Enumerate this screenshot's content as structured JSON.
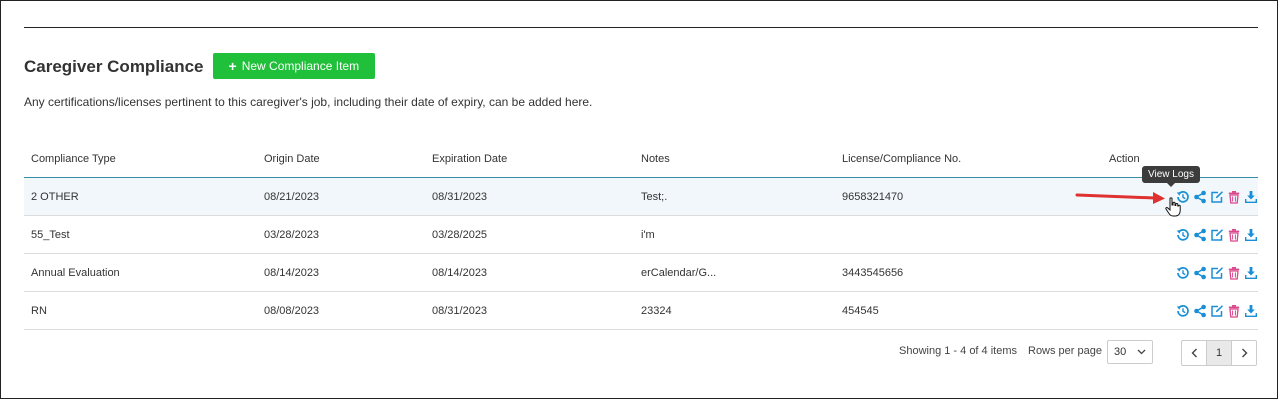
{
  "title": "Caregiver Compliance",
  "new_button": "New Compliance Item",
  "description": "Any certifications/licenses pertinent to this caregiver's job, including their date of expiry, can be added here.",
  "columns": [
    "Compliance Type",
    "Origin Date",
    "Expiration Date",
    "Notes",
    "License/Compliance No.",
    "Action"
  ],
  "rows": [
    {
      "type": "2 OTHER",
      "origin": "08/21/2023",
      "expiration": "08/31/2023",
      "notes": "Test;.",
      "license": "9658321470"
    },
    {
      "type": "55_Test",
      "origin": "03/28/2023",
      "expiration": "03/28/2025",
      "notes": "i'm",
      "license": ""
    },
    {
      "type": "Annual Evaluation",
      "origin": "08/14/2023",
      "expiration": "08/14/2023",
      "notes": "erCalendar/G...",
      "license": "3443545656"
    },
    {
      "type": "RN",
      "origin": "08/08/2023",
      "expiration": "08/31/2023",
      "notes": "23324",
      "license": "454545"
    }
  ],
  "tooltip": "View Logs",
  "pagination": {
    "showing": "Showing 1 - 4 of 4 items",
    "rows_per_page_label": "Rows per page",
    "rows_per_page": "30",
    "current_page": "1"
  },
  "colors": {
    "accent_green": "#20c03a",
    "icon_blue": "#1a8fd6",
    "delete_pink": "#d9478c",
    "header_rule": "#3a8fa8",
    "annotation_red": "#e03131"
  },
  "icons": [
    "history-icon",
    "share-icon",
    "edit-icon",
    "trash-icon",
    "download-icon"
  ]
}
